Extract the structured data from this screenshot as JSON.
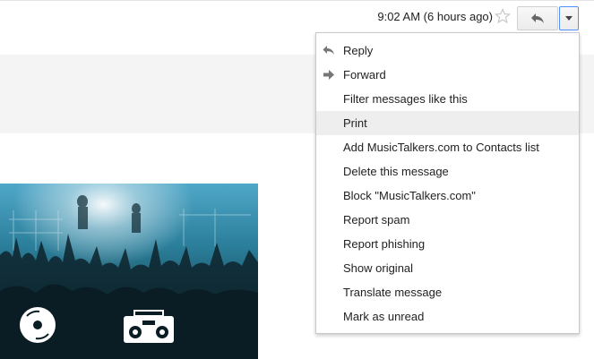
{
  "header": {
    "timestamp": "9:02 AM (6 hours ago)",
    "star_icon": "star-outline-icon",
    "reply_icon": "reply-arrow-icon",
    "more_icon": "caret-down-icon"
  },
  "menu": {
    "items": [
      {
        "label": "Reply",
        "icon": "reply-icon"
      },
      {
        "label": "Forward",
        "icon": "forward-icon"
      },
      {
        "label": "Filter messages like this"
      },
      {
        "label": "Print",
        "state": "hover"
      },
      {
        "label": "Add MusicTalkers.com to Contacts list"
      },
      {
        "label": "Delete this message"
      },
      {
        "label": "Block \"MusicTalkers.com\""
      },
      {
        "label": "Report spam"
      },
      {
        "label": "Report phishing"
      },
      {
        "label": "Show original"
      },
      {
        "label": "Translate message"
      },
      {
        "label": "Mark as unread"
      }
    ]
  },
  "colors": {
    "menu_hover": "#eeeeee",
    "focus_border": "#4d90fe",
    "band": "#f4f4f4",
    "hero_dark": "#143a44"
  },
  "hero": {
    "icons": [
      "disc-icon",
      "boombox-icon"
    ]
  }
}
